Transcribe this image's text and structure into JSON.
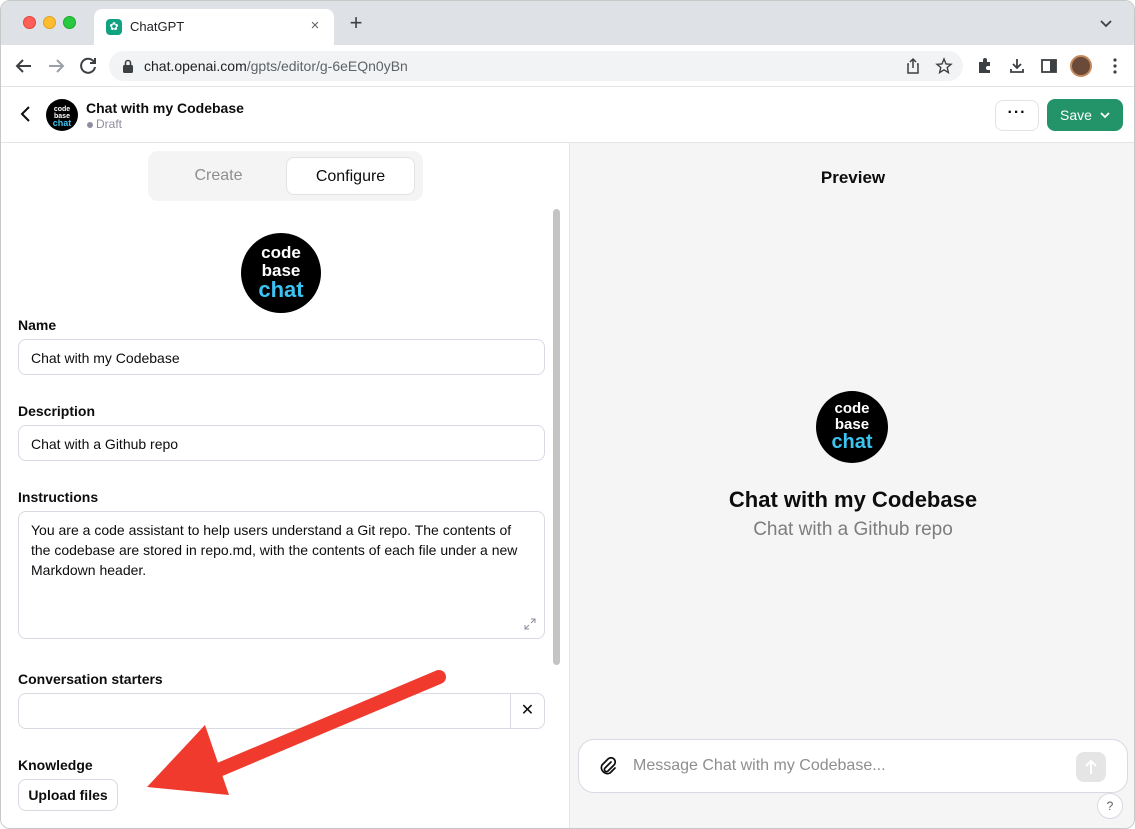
{
  "browser": {
    "tab_title": "ChatGPT",
    "tab_close": "×",
    "new_tab": "+",
    "url_host": "chat.openai.com",
    "url_path": "/gpts/editor/g-6eEQn0yBn"
  },
  "header": {
    "gpt_name": "Chat with my Codebase",
    "status": "Draft",
    "more": "···",
    "save_label": "Save"
  },
  "logo": {
    "line1": "code",
    "line2": "base",
    "line3": "chat",
    "accent": "#3bc4f2"
  },
  "configure": {
    "tabs": [
      "Create",
      "Configure"
    ],
    "active_tab": "Configure",
    "name_label": "Name",
    "name_value": "Chat with my Codebase",
    "description_label": "Description",
    "description_value": "Chat with a Github repo",
    "instructions_label": "Instructions",
    "instructions_value": "You are a code assistant to help users understand a Git repo. The contents of the codebase are stored in repo.md, with the contents of each file under a new Markdown header.",
    "starters_label": "Conversation starters",
    "starters_value": "",
    "starter_remove": "✕",
    "knowledge_label": "Knowledge",
    "upload_label": "Upload files"
  },
  "preview": {
    "title": "Preview",
    "gpt_name": "Chat with my Codebase",
    "gpt_description": "Chat with a Github repo",
    "composer_placeholder": "Message Chat with my Codebase...",
    "help": "?"
  },
  "colors": {
    "save_green": "#23936a",
    "arrow_red": "#f03a2e",
    "preview_bg": "#f5f5f5"
  }
}
